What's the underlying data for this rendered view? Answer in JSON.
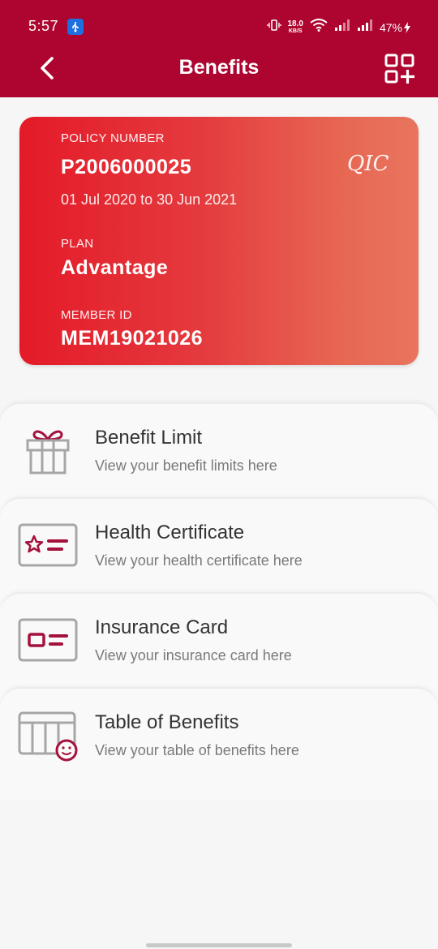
{
  "status_bar": {
    "time": "5:57",
    "speed_value": "18.0",
    "speed_unit": "KB/S",
    "battery": "47%"
  },
  "header": {
    "title": "Benefits",
    "back_icon": "chevron-left-icon",
    "action_icon": "qr-add-icon"
  },
  "card": {
    "policy_label": "POLICY NUMBER",
    "policy_number": "P2006000025",
    "period": "01 Jul 2020 to 30 Jun 2021",
    "plan_label": "PLAN",
    "plan": "Advantage",
    "member_label": "MEMBER ID",
    "member_id": "MEM19021026",
    "logo_text": "QIC"
  },
  "menu": [
    {
      "title": "Benefit Limit",
      "desc": "View your benefit limits here",
      "icon": "gift-icon"
    },
    {
      "title": "Health Certificate",
      "desc": "View your health certificate here",
      "icon": "certificate-icon"
    },
    {
      "title": "Insurance Card",
      "desc": "View your insurance card here",
      "icon": "id-card-icon"
    },
    {
      "title": "Table of Benefits",
      "desc": "View your table of benefits here",
      "icon": "table-icon"
    }
  ],
  "colors": {
    "brand": "#ad0530",
    "accent": "#a4113c",
    "icon_gray": "#a6a6a6"
  }
}
